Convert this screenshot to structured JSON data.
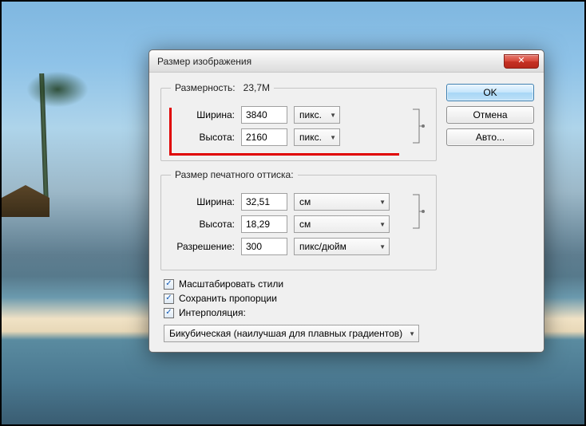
{
  "dialog": {
    "title": "Размер изображения",
    "buttons": {
      "ok": "OK",
      "cancel": "Отмена",
      "auto": "Авто..."
    }
  },
  "dimensions": {
    "legend": "Размерность:",
    "size": "23,7M",
    "width_label": "Ширина:",
    "width_value": "3840",
    "width_unit": "пикс.",
    "height_label": "Высота:",
    "height_value": "2160",
    "height_unit": "пикс."
  },
  "print": {
    "legend": "Размер печатного оттиска:",
    "width_label": "Ширина:",
    "width_value": "32,51",
    "width_unit": "см",
    "height_label": "Высота:",
    "height_value": "18,29",
    "height_unit": "см",
    "res_label": "Разрешение:",
    "res_value": "300",
    "res_unit": "пикс/дюйм"
  },
  "options": {
    "scale_styles": "Масштабировать стили",
    "keep_proportions": "Сохранить пропорции",
    "interpolation": "Интерполяция:",
    "method": "Бикубическая (наилучшая для плавных градиентов)"
  }
}
